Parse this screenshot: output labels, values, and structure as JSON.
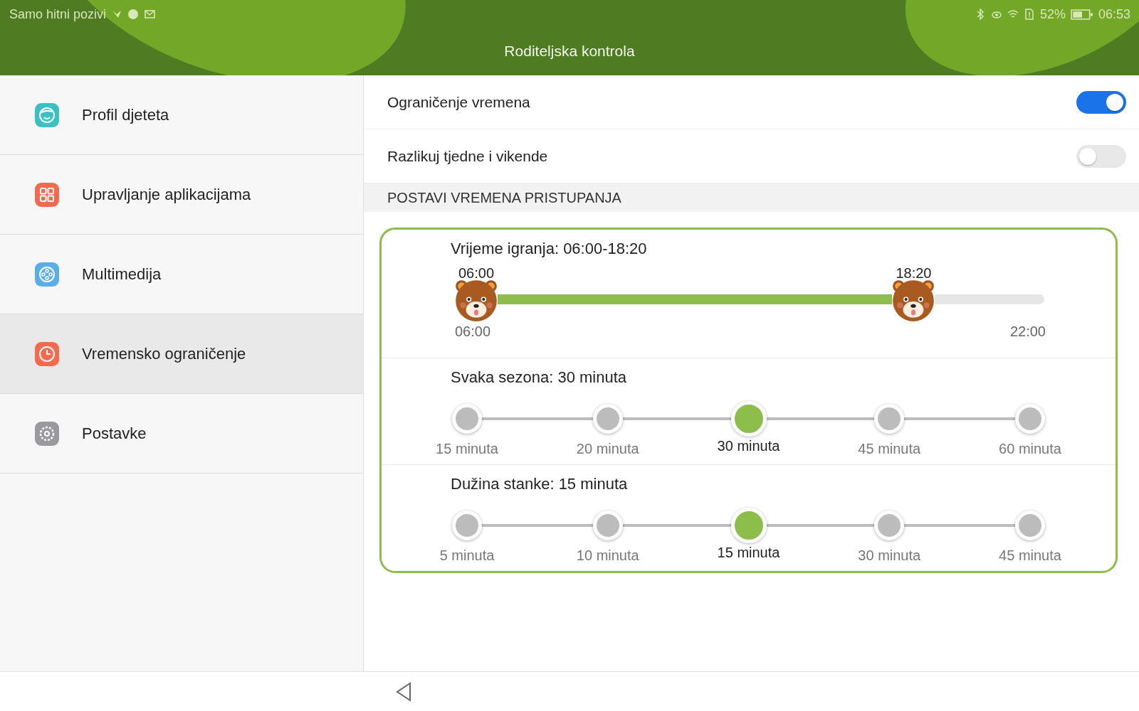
{
  "status_bar": {
    "carrier": "Samo hitni pozivi",
    "battery": "52%",
    "time": "06:53"
  },
  "header": {
    "title": "Roditeljska kontrola"
  },
  "sidebar": {
    "items": [
      {
        "label": "Profil djeteta",
        "color": "#3cc0c4",
        "selected": false
      },
      {
        "label": "Upravljanje aplikacijama",
        "color": "#f26b4f",
        "selected": false
      },
      {
        "label": "Multimedija",
        "color": "#5aaee8",
        "selected": false
      },
      {
        "label": "Vremensko ograničenje",
        "color": "#f46a4c",
        "selected": true
      },
      {
        "label": "Postavke",
        "color": "#9a9a9e",
        "selected": false
      }
    ]
  },
  "settings": [
    {
      "label": "Ograničenje vremena",
      "on": true
    },
    {
      "label": "Razlikuj tjedne i vikende",
      "on": false
    }
  ],
  "section_header": "POSTAVI VREMENA PRISTUPANJA",
  "play_time": {
    "title": "Vrijeme igranja: 06:00-18:20",
    "min_label": "06:00",
    "max_label": "22:00",
    "handles": [
      {
        "label": "06:00",
        "level": 0
      },
      {
        "label": "18:20",
        "level": 0.77
      }
    ]
  },
  "step_sliders": [
    {
      "title": "Svaka sezona: 30 minuta",
      "options": [
        {
          "label": "15 minuta",
          "selected": false
        },
        {
          "label": "20 minuta",
          "selected": false
        },
        {
          "label": "30 minuta",
          "selected": true
        },
        {
          "label": "45 minuta",
          "selected": false
        },
        {
          "label": "60 minuta",
          "selected": false
        }
      ]
    },
    {
      "title": "Dužina stanke: 15 minuta",
      "options": [
        {
          "label": "5 minuta",
          "selected": false
        },
        {
          "label": "10 minuta",
          "selected": false
        },
        {
          "label": "15 minuta",
          "selected": true
        },
        {
          "label": "30 minuta",
          "selected": false
        },
        {
          "label": "45 minuta",
          "selected": false
        }
      ]
    }
  ]
}
